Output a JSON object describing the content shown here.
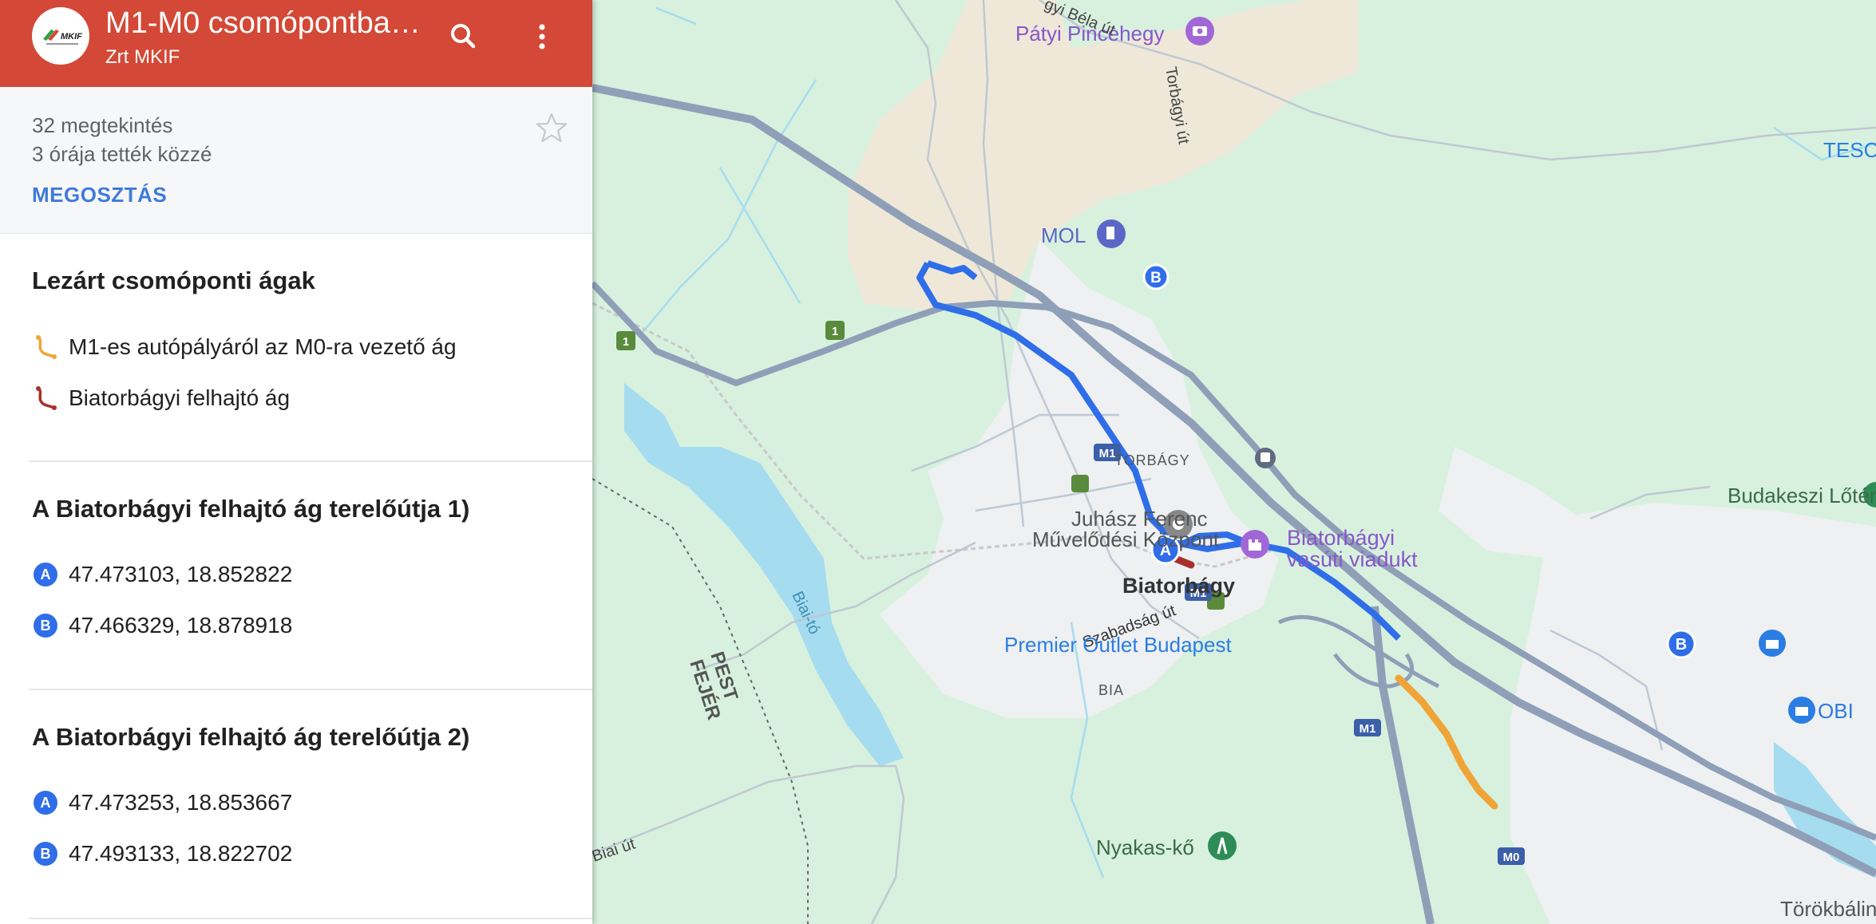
{
  "header": {
    "title": "M1-M0 csomópontba…",
    "subtitle": "Zrt MKIF",
    "logo_text": "MKIF",
    "background": "#d34836"
  },
  "info": {
    "views": "32 megtekintés",
    "published": "3 órája tették közzé",
    "share_label": "MEGOSZTÁS"
  },
  "legend": {
    "title": "Lezárt csomóponti ágak",
    "items": [
      {
        "label": "M1-es autópályáról az M0-ra vezető ág",
        "color": "#f0a438",
        "icon": "route-icon"
      },
      {
        "label": "Biatorbágyi felhajtó ág",
        "color": "#a8302c",
        "icon": "route-icon"
      }
    ]
  },
  "detours": [
    {
      "title": "A Biatorbágyi felhajtó ág terelőútja 1)",
      "points": [
        {
          "marker": "A",
          "coords": "47.473103, 18.852822"
        },
        {
          "marker": "B",
          "coords": "47.466329, 18.878918"
        }
      ]
    },
    {
      "title": "A Biatorbágyi felhajtó ág terelőútja 2)",
      "points": [
        {
          "marker": "A",
          "coords": "47.473253, 18.853667"
        },
        {
          "marker": "B",
          "coords": "47.493133, 18.822702"
        }
      ]
    }
  ],
  "map": {
    "colors": {
      "route_blue": "#2f6ee8",
      "closure_orange": "#f0a438",
      "closure_red": "#a8302c",
      "motorway": "#8f9fb8",
      "water": "#a6dcef"
    },
    "labels": {
      "patyi": "Pátyi Pincehegy",
      "bela": "gyi Béla út",
      "torbagyi_ut": "Torbágyi út",
      "tesco": "TESCO",
      "mol": "MOL",
      "torbagy": "TORBÁGY",
      "budakeszi": "Budakeszi Lőtér",
      "juhasz1": "Juhász Ferenc",
      "juhasz2": "Művelődési Központ",
      "viadukt1": "Biatorbágyi",
      "viadukt2": "vasúti viadukt",
      "biatorbagy": "Biatorbágy",
      "szabadsag": "Szabadság út",
      "bia": "BIA",
      "biai_to": "Biai-tó",
      "pest": "PEST",
      "fejer": "FEJÉR",
      "premier": "Premier Outlet Budapest",
      "obi": "OBI",
      "nyakas": "Nyakas-kő",
      "biai_ut": "Biai út",
      "torokbalint": "Törökbálint",
      "shield_1": "1",
      "m1": "M1",
      "m0": "M0",
      "marker_a": "A",
      "marker_b": "B"
    }
  }
}
